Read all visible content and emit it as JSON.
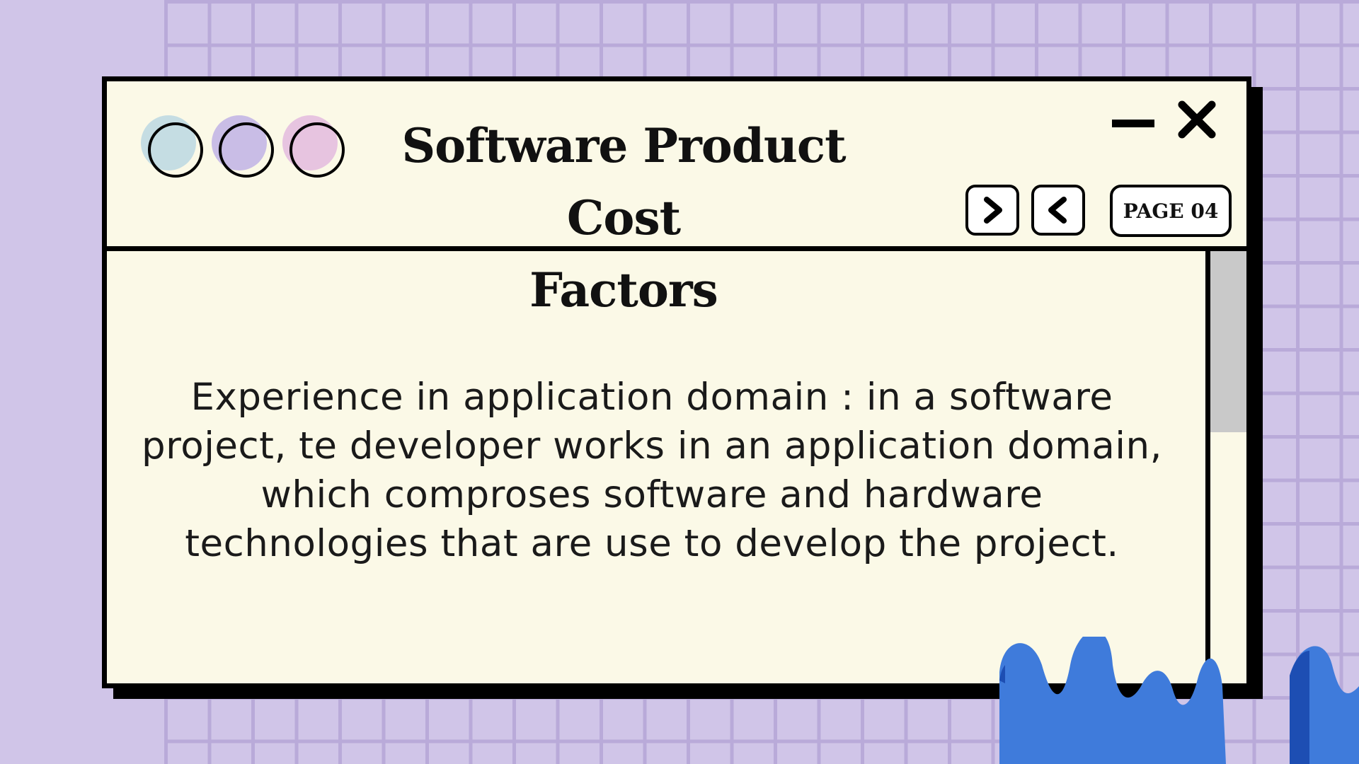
{
  "window": {
    "title_line1": "Software Product Cost",
    "title_line2": "Factors",
    "page_label": "PAGE 04"
  },
  "controls": {
    "dots": [
      {
        "name": "blue-dot",
        "color": "#c5dde3"
      },
      {
        "name": "purple-dot",
        "color": "#c9bde6"
      },
      {
        "name": "pink-dot",
        "color": "#e7c4e0"
      }
    ],
    "icons": [
      "minimize-icon",
      "close-icon",
      "chevron-right-icon",
      "chevron-left-icon"
    ]
  },
  "content": {
    "lines": [
      "Experience in application domain : in a software",
      "project, te developer works in an application domain,",
      "which comproses software and hardware",
      "technologies that are use to develop the project."
    ]
  },
  "scrollbar": {
    "position": 0
  },
  "colors": {
    "background": "#d0c5e8",
    "grid": "#b9aad9",
    "window": "#fbf9e7",
    "wave": "#3f7bdb",
    "wave_overlap": "#1d4eb3"
  }
}
